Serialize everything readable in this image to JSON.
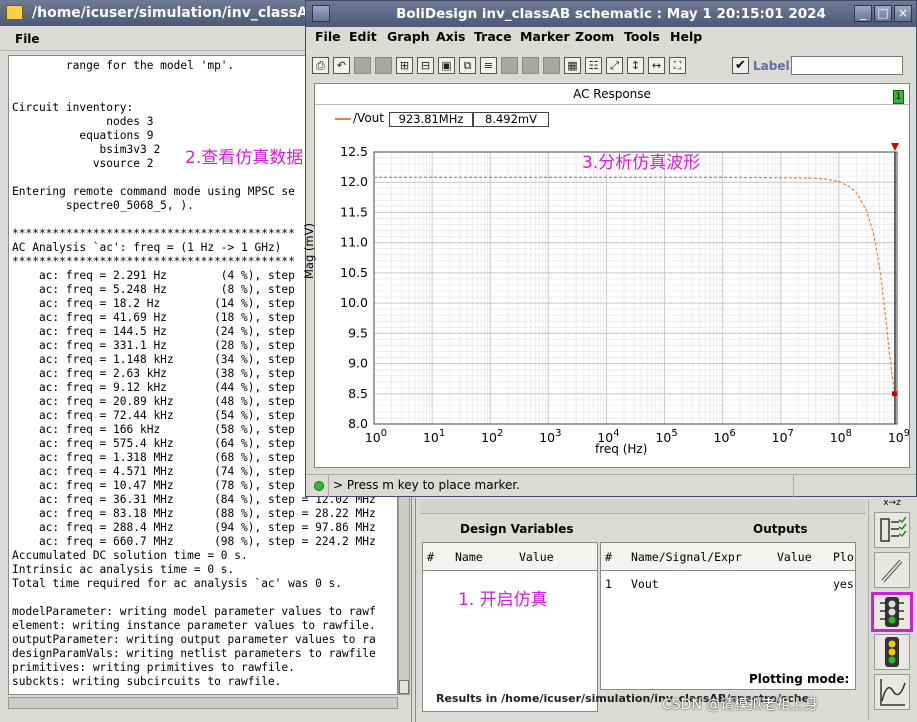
{
  "log_window": {
    "title": "/home/icuser/simulation/inv_classAB/",
    "menu": {
      "file": "File"
    },
    "lines": [
      "        range for the model 'mp'.",
      "",
      "",
      "Circuit inventory:",
      "              nodes 3",
      "          equations 9",
      "             bsim3v3 2",
      "            vsource 2",
      "",
      "Entering remote command mode using MPSC se",
      "        spectre0_5068_5, ).",
      "",
      "******************************************",
      "AC Analysis `ac': freq = (1 Hz -> 1 GHz)",
      "******************************************",
      "    ac: freq = 2.291 Hz        (4 %), step",
      "    ac: freq = 5.248 Hz        (8 %), step",
      "    ac: freq = 18.2 Hz        (14 %), step",
      "    ac: freq = 41.69 Hz       (18 %), step",
      "    ac: freq = 144.5 Hz       (24 %), step",
      "    ac: freq = 331.1 Hz       (28 %), step",
      "    ac: freq = 1.148 kHz      (34 %), step",
      "    ac: freq = 2.63 kHz       (38 %), step",
      "    ac: freq = 9.12 kHz       (44 %), step",
      "    ac: freq = 20.89 kHz      (48 %), step",
      "    ac: freq = 72.44 kHz      (54 %), step",
      "    ac: freq = 166 kHz        (58 %), step",
      "    ac: freq = 575.4 kHz      (64 %), step",
      "    ac: freq = 1.318 MHz      (68 %), step",
      "    ac: freq = 4.571 MHz      (74 %), step",
      "    ac: freq = 10.47 MHz      (78 %), step",
      "    ac: freq = 36.31 MHz      (84 %), step = 12.02 MHz",
      "    ac: freq = 83.18 MHz      (88 %), step = 28.22 MHz",
      "    ac: freq = 288.4 MHz      (94 %), step = 97.86 MHz",
      "    ac: freq = 660.7 MHz      (98 %), step = 224.2 MHz",
      "Accumulated DC solution time = 0 s.",
      "Intrinsic ac analysis time = 0 s.",
      "Total time required for ac analysis `ac' was 0 s.",
      "",
      "modelParameter: writing model parameter values to rawf",
      "element: writing instance parameter values to rawfile.",
      "outputParameter: writing output parameter values to ra",
      "designParamVals: writing netlist parameters to rawfile",
      "primitives: writing primitives to rawfile.",
      "subckts: writing subcircuits to rawfile."
    ]
  },
  "annotations": {
    "view_data": "2.查看仿真数据",
    "analyze_waveform": "3.分析仿真波形",
    "start_sim": "1. 开启仿真"
  },
  "plot_window": {
    "title": "BoliDesign inv_classAB schematic : May  1 20:15:01 2024",
    "window_buttons": {
      "minimize": "_",
      "maximize": "□",
      "close": "×"
    },
    "menu": [
      "File",
      "Edit",
      "Graph",
      "Axis",
      "Trace",
      "Marker",
      "Zoom",
      "Tools",
      "Help"
    ],
    "label_checkbox": "Label",
    "label_checked": true,
    "label_input_value": "",
    "subwindow_index": "1",
    "status_text": "> Press m key to place marker."
  },
  "ade_window": {
    "design_variables_title": "Design Variables",
    "outputs_title": "Outputs",
    "dv_columns": [
      "#",
      "Name",
      "Value"
    ],
    "out_columns": [
      "#",
      "Name/Signal/Expr",
      "Value",
      "Plo"
    ],
    "outputs": [
      {
        "index": "1",
        "name": "Vout",
        "value": "",
        "plot": "yes"
      }
    ],
    "plotting_mode_label": "Plotting mode:",
    "results_partial": "Results in /home/icuser/simulation/inv_classAB/spectre/sche",
    "toolbar_top_label": "x→z"
  },
  "watermark": "CSDN @请模拟老祖上身",
  "colors": {
    "title_bar": "#55617e",
    "trace": "#e0823a",
    "annotation": "#d21ed6",
    "highlight_box": "#d21ed6",
    "marker_triangle": "#d40000",
    "status_led": "#2dbb2d"
  },
  "chart_data": {
    "type": "line",
    "title": "AC Response",
    "xlabel": "freq (Hz)",
    "ylabel": "Mag (mV)",
    "x_scale": "log",
    "xlim": [
      1,
      1000000000
    ],
    "ylim": [
      8.0,
      12.5
    ],
    "x_ticks": [
      {
        "value": 1,
        "mantissa": "10",
        "exp": "0"
      },
      {
        "value": 10,
        "mantissa": "10",
        "exp": "1"
      },
      {
        "value": 100,
        "mantissa": "10",
        "exp": "2"
      },
      {
        "value": 1000,
        "mantissa": "10",
        "exp": "3"
      },
      {
        "value": 10000,
        "mantissa": "10",
        "exp": "4"
      },
      {
        "value": 100000,
        "mantissa": "10",
        "exp": "5"
      },
      {
        "value": 1000000,
        "mantissa": "10",
        "exp": "6"
      },
      {
        "value": 10000000,
        "mantissa": "10",
        "exp": "7"
      },
      {
        "value": 100000000,
        "mantissa": "10",
        "exp": "8"
      },
      {
        "value": 1000000000,
        "mantissa": "10",
        "exp": "9"
      }
    ],
    "y_ticks": [
      "8.0",
      "8.5",
      "9.0",
      "9.5",
      "10.0",
      "10.5",
      "11.0",
      "11.5",
      "12.0",
      "12.5"
    ],
    "grid": true,
    "legend_position": "top-left",
    "series": [
      {
        "name": "/Vout",
        "color": "#e0823a",
        "dashed": true,
        "x": [
          1,
          10,
          100,
          1000,
          10000,
          100000,
          1000000,
          10000000,
          30000000,
          50000000,
          70000000,
          100000000,
          150000000,
          200000000,
          300000000,
          400000000,
          500000000,
          600000000,
          700000000,
          800000000,
          923810000
        ],
        "y": [
          12.08,
          12.08,
          12.08,
          12.08,
          12.08,
          12.08,
          12.08,
          12.075,
          12.07,
          12.06,
          12.04,
          12.01,
          11.93,
          11.83,
          11.53,
          11.12,
          10.6,
          10.0,
          9.4,
          8.9,
          8.492
        ]
      }
    ],
    "marker": {
      "x_readout": "923.81MHz",
      "y_readout": "8.492mV",
      "x": 923810000,
      "y": 8.492
    }
  }
}
